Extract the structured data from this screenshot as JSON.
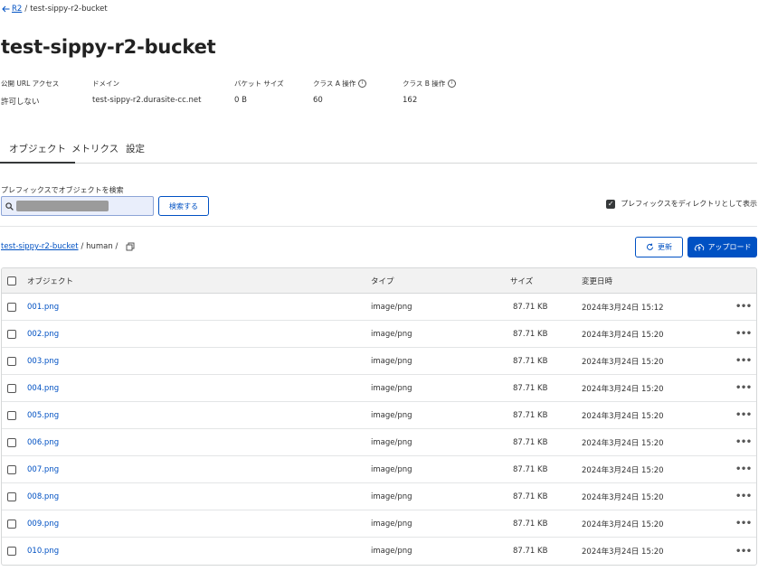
{
  "breadcrumb": {
    "back_label": "R2",
    "separator": "/",
    "current": "test-sippy-r2-bucket"
  },
  "page_title": "test-sippy-r2-bucket",
  "meta": [
    {
      "label": "公開 URL アクセス",
      "value": "許可しない",
      "info": false
    },
    {
      "label": "ドメイン",
      "value": "test-sippy-r2.durasite-cc.net",
      "info": false
    },
    {
      "label": "バケット サイズ",
      "value": "0 B",
      "info": false
    },
    {
      "label": "クラス A 操作",
      "value": "60",
      "info": true
    },
    {
      "label": "クラス B 操作",
      "value": "162",
      "info": true
    }
  ],
  "tabs": [
    {
      "label": "オブジェクト",
      "active": true
    },
    {
      "label": "メトリクス",
      "active": false
    },
    {
      "label": "設定",
      "active": false
    }
  ],
  "search": {
    "label": "プレフィックスでオブジェクトを検索",
    "button_label": "検索する"
  },
  "prefix_dir": {
    "label": "プレフィックスをディレクトリとして表示",
    "checked": true
  },
  "path": {
    "bucket": "test-sippy-r2-bucket",
    "rest": "/ human /"
  },
  "actions": {
    "refresh_label": "更新",
    "upload_label": "アップロード"
  },
  "table": {
    "headers": {
      "name": "オブジェクト",
      "type": "タイプ",
      "size": "サイズ",
      "date": "変更日時"
    },
    "rows": [
      {
        "name": "001.png",
        "type": "image/png",
        "size": "87.71 KB",
        "date": "2024年3月24日 15:12"
      },
      {
        "name": "002.png",
        "type": "image/png",
        "size": "87.71 KB",
        "date": "2024年3月24日 15:20"
      },
      {
        "name": "003.png",
        "type": "image/png",
        "size": "87.71 KB",
        "date": "2024年3月24日 15:20"
      },
      {
        "name": "004.png",
        "type": "image/png",
        "size": "87.71 KB",
        "date": "2024年3月24日 15:20"
      },
      {
        "name": "005.png",
        "type": "image/png",
        "size": "87.71 KB",
        "date": "2024年3月24日 15:20"
      },
      {
        "name": "006.png",
        "type": "image/png",
        "size": "87.71 KB",
        "date": "2024年3月24日 15:20"
      },
      {
        "name": "007.png",
        "type": "image/png",
        "size": "87.71 KB",
        "date": "2024年3月24日 15:20"
      },
      {
        "name": "008.png",
        "type": "image/png",
        "size": "87.71 KB",
        "date": "2024年3月24日 15:20"
      },
      {
        "name": "009.png",
        "type": "image/png",
        "size": "87.71 KB",
        "date": "2024年3月24日 15:20"
      },
      {
        "name": "010.png",
        "type": "image/png",
        "size": "87.71 KB",
        "date": "2024年3月24日 15:20"
      }
    ],
    "more_label": "•••"
  },
  "colors": {
    "accent": "#0051c3",
    "text": "#313131",
    "border": "#d5d7d8"
  }
}
